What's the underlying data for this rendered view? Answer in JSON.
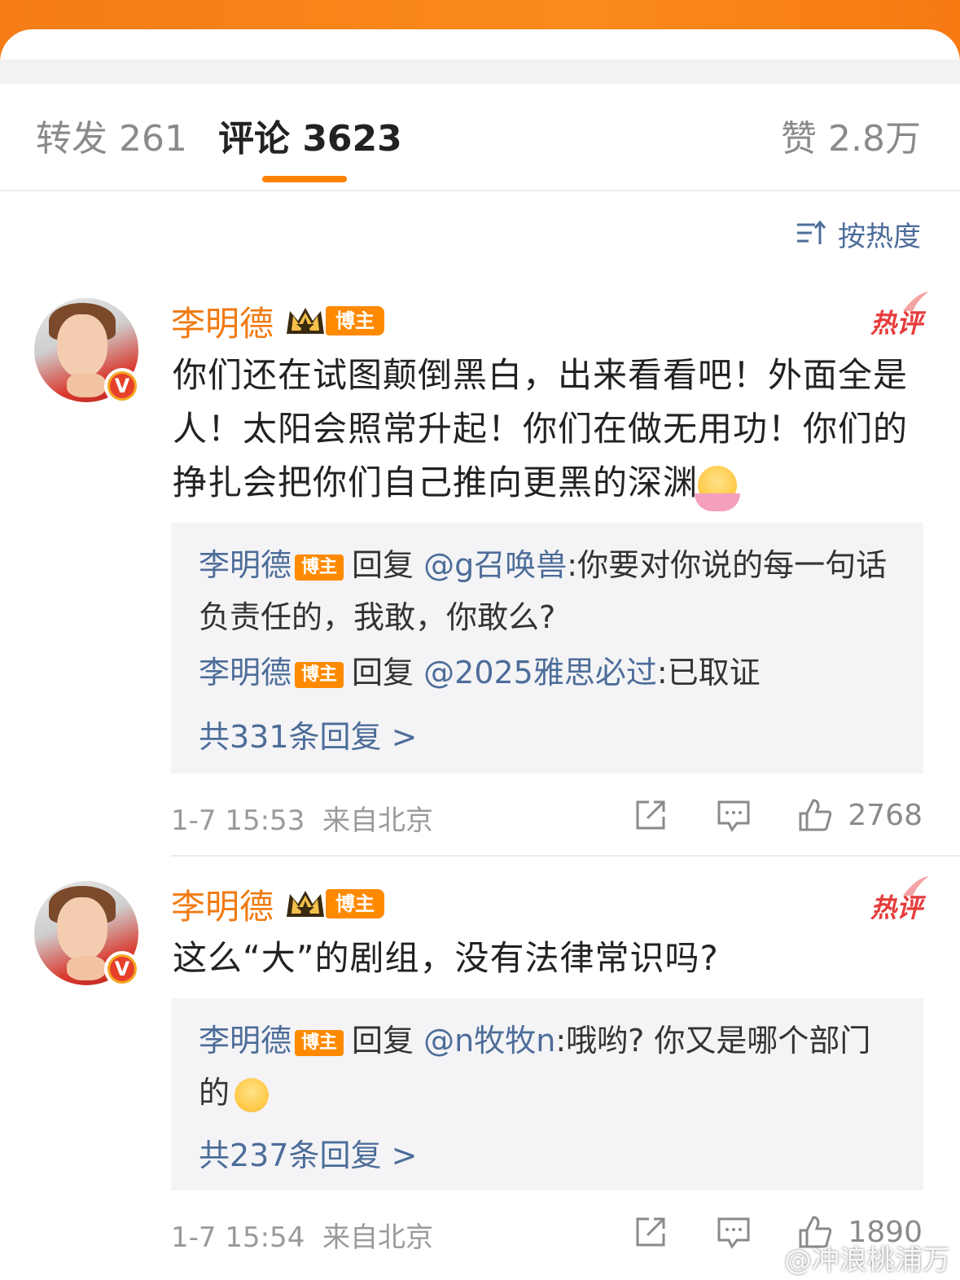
{
  "tabs": {
    "repost": "转发 261",
    "comment": "评论 3623",
    "like": "赞 2.8万"
  },
  "sort": {
    "label": "按热度",
    "icon": "sort-icon"
  },
  "comments": [
    {
      "name": "李明德",
      "badge": "博主",
      "hot": "热评",
      "content": "你们还在试图颠倒黑白，出来看看吧！外面全是人！太阳会照常升起！你们在做无用功！你们的挣扎会把你们自己推向更黑的深渊",
      "replies": [
        {
          "name": "李明德",
          "badge": "博主",
          "verb": "回复",
          "target": "@g召唤兽",
          "text": ":你要对你说的每一句话负责任的，我敢，你敢么?"
        },
        {
          "name": "李明德",
          "badge": "博主",
          "verb": "回复",
          "target": "@2025雅思必过",
          "text": ":已取证"
        }
      ],
      "more": "共331条回复 >",
      "time": "1-7 15:53",
      "location": "来自北京",
      "likes": "2768"
    },
    {
      "name": "李明德",
      "badge": "博主",
      "hot": "热评",
      "content": "这么“大”的剧组，没有法律常识吗?",
      "replies": [
        {
          "name": "李明德",
          "badge": "博主",
          "verb": "回复",
          "target": "@n牧牧n",
          "text": ":哦哟? 你又是哪个部门的"
        }
      ],
      "more": "共237条回复 >",
      "time": "1-7 15:54",
      "location": "来自北京",
      "likes": "1890"
    }
  ],
  "watermark": "@冲浪桃浦万"
}
